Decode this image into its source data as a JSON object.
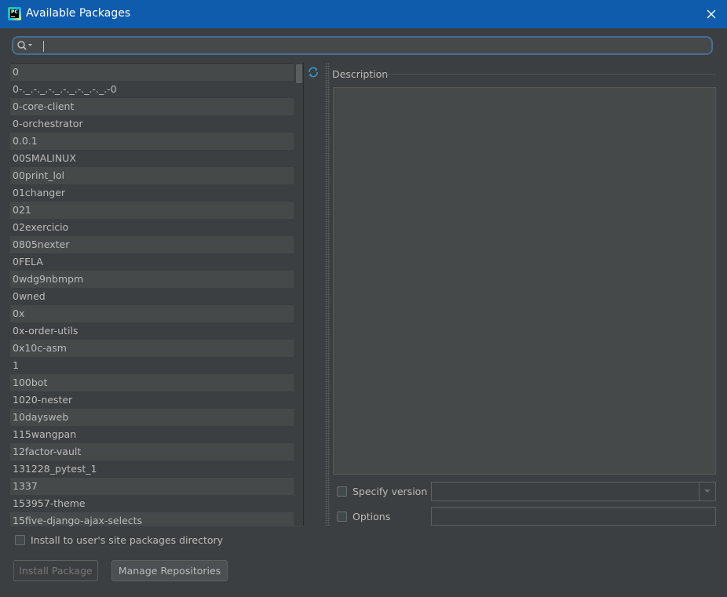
{
  "window": {
    "title": "Available Packages",
    "accent_color": "#0f5cad"
  },
  "search": {
    "value": "",
    "placeholder": ""
  },
  "packages": [
    "0",
    "0-._.-._.-._.-._.-._.-._.-0",
    "0-core-client",
    "0-orchestrator",
    "0.0.1",
    "00SMALINUX",
    "00print_lol",
    "01changer",
    "021",
    "02exercicio",
    "0805nexter",
    "0FELA",
    "0wdg9nbmpm",
    "0wned",
    "0x",
    "0x-order-utils",
    "0x10c-asm",
    "1",
    "100bot",
    "1020-nester",
    "10daysweb",
    "115wangpan",
    "12factor-vault",
    "131228_pytest_1",
    "1337",
    "153957-theme",
    "15five-django-ajax-selects"
  ],
  "description": {
    "label": "Description",
    "text": ""
  },
  "options": {
    "specify_version_label": "Specify version",
    "specify_version_checked": false,
    "version_value": "",
    "options_label": "Options",
    "options_checked": false,
    "options_value": ""
  },
  "install_user_site": {
    "label": "Install to user's site packages directory",
    "checked": false
  },
  "buttons": {
    "install": "Install Package",
    "manage_repositories": "Manage Repositories"
  },
  "icons": {
    "app": "pycharm-icon",
    "close": "close-icon",
    "search": "search-icon",
    "refresh": "refresh-icon",
    "dropdown": "chevron-down-icon"
  }
}
